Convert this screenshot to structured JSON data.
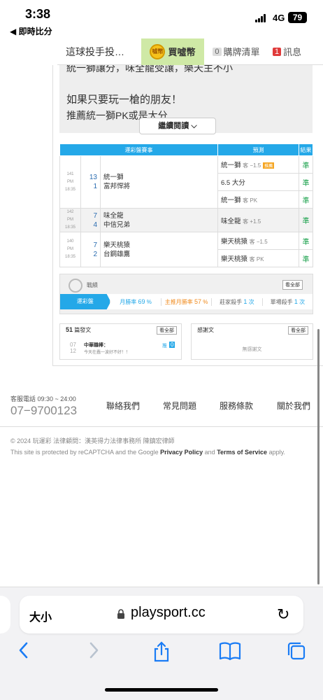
{
  "status": {
    "time": "3:38",
    "back_app": "◀ 即時比分",
    "network": "4G",
    "battery": "79"
  },
  "nav": {
    "title": "這球投手投…",
    "buy_label": "買噓幣",
    "coin_text": "噓幣",
    "cart_count": "0",
    "cart_label": "購牌清單",
    "msg_count": "1",
    "msg_label": "訊息"
  },
  "article": {
    "line0": "統一獅讓分，味全龍受讓，樂天主不小",
    "line1": "如果只要玩一槍的朋友！",
    "line2": "推薦統一獅PK或是大分",
    "readmore": "繼續閱讀 ⌵"
  },
  "picks": {
    "headers": [
      "運彩盤賽事",
      "預測",
      "結果"
    ],
    "games": [
      {
        "num": "141",
        "time": "PM 18:35",
        "s1": "13",
        "t1": "統一獅",
        "s2": "1",
        "t2": "富邦悍將",
        "preds": [
          {
            "team": "統一獅",
            "note": "客 −1.5",
            "tag": "推薦",
            "res": "準"
          },
          {
            "team": "6.5 大分",
            "note": "",
            "tag": "",
            "res": "準"
          },
          {
            "team": "統一獅",
            "note": "客 PK",
            "tag": "",
            "res": "準"
          }
        ]
      },
      {
        "num": "142",
        "time": "PM 18:35",
        "s1": "7",
        "t1": "味全龍",
        "s2": "4",
        "t2": "中信兄弟",
        "preds": [
          {
            "team": "味全龍",
            "note": "客 +1.5",
            "tag": "",
            "res": "準"
          }
        ]
      },
      {
        "num": "140",
        "time": "PM 18:35",
        "s1": "7",
        "t1": "樂天桃猿",
        "s2": "2",
        "t2": "台鋼雄鷹",
        "preds": [
          {
            "team": "樂天桃猿",
            "note": "客 −1.5",
            "tag": "",
            "res": "準"
          },
          {
            "team": "樂天桃猿",
            "note": "客 PK",
            "tag": "",
            "res": "準"
          }
        ]
      }
    ]
  },
  "stats": {
    "title": "戰績",
    "all": "看全部",
    "items": [
      {
        "label": "運彩盤",
        "value": ""
      },
      {
        "label": "月勝率",
        "value": "69",
        "unit": "%"
      },
      {
        "label": "主推月勝率",
        "value": "57",
        "unit": "%"
      },
      {
        "label": "莊家殺手",
        "value": "1",
        "unit": "次"
      },
      {
        "label": "單場殺手",
        "value": "1",
        "unit": "次"
      }
    ]
  },
  "posts": {
    "count": "51",
    "head": "篇發文",
    "more": "看全部",
    "month": "07",
    "day": "12",
    "name": "中華職棒：",
    "snippet": "今天在蠢一波好不好！！",
    "push": "推",
    "push_count": "0"
  },
  "thanks": {
    "head": "感謝文",
    "more": "看全部",
    "empty": "無感謝文"
  },
  "footer": {
    "svc_label": "客服電話 09:30 ~ 24:00",
    "phone": "07−9700123",
    "links": [
      "聯絡我們",
      "常見問題",
      "服務條款",
      "關於我們"
    ],
    "copyright": "© 2024 玩運彩 法律顧問：漢英得力法律事務所 陳鎮宏律師",
    "recaptcha_a": "This site is protected by reCAPTCHA and the Google ",
    "privacy": "Privacy Policy",
    "and": " and ",
    "terms": "Terms of Service",
    "apply": " apply."
  },
  "safari": {
    "textsize": "大小",
    "url": "playsport.cc"
  },
  "colors": {
    "accent": "#24a8e8",
    "win": "#18a04a",
    "buy_bg": "#cfe9a6",
    "link": "#1a7cf5"
  }
}
